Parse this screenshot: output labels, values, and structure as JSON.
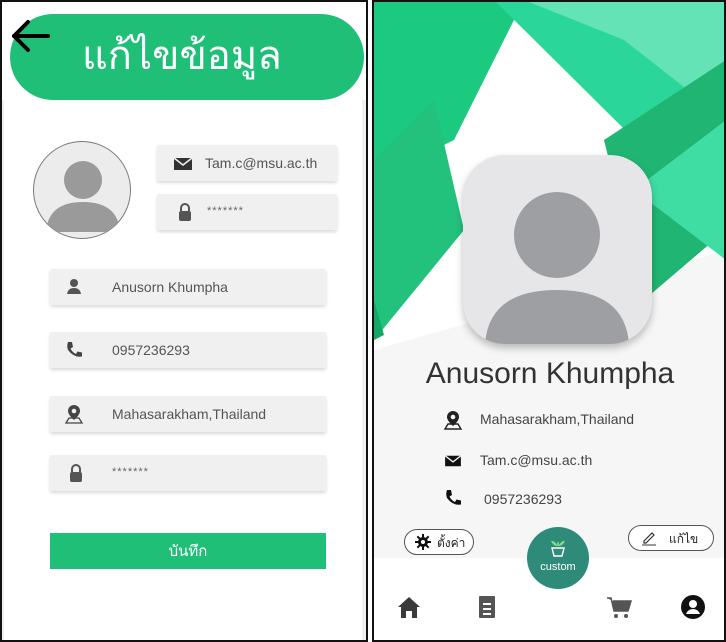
{
  "edit_screen": {
    "title": "แก้ไขข้อมูล",
    "email": "Tam.c@msu.ac.th",
    "password_top": "*******",
    "name": "Anusorn Khumpha",
    "phone": "0957236293",
    "address": "Mahasarakham,Thailand",
    "password_bottom": "*******",
    "save_label": "บันทึก"
  },
  "profile_screen": {
    "name": "Anusorn Khumpha",
    "address": "Mahasarakham,Thailand",
    "email": "Tam.c@msu.ac.th",
    "phone": "0957236293",
    "settings_label": "ตั้งค่า",
    "edit_label": "แก้ไข",
    "custom_label": "custom",
    "nav_items": [
      "home-icon",
      "document-icon",
      "cart-icon",
      "account-icon"
    ]
  },
  "colors": {
    "accent_green": "#1fbf77",
    "teal_button": "#2e8b7a",
    "field_bg": "#f0f0f0"
  }
}
